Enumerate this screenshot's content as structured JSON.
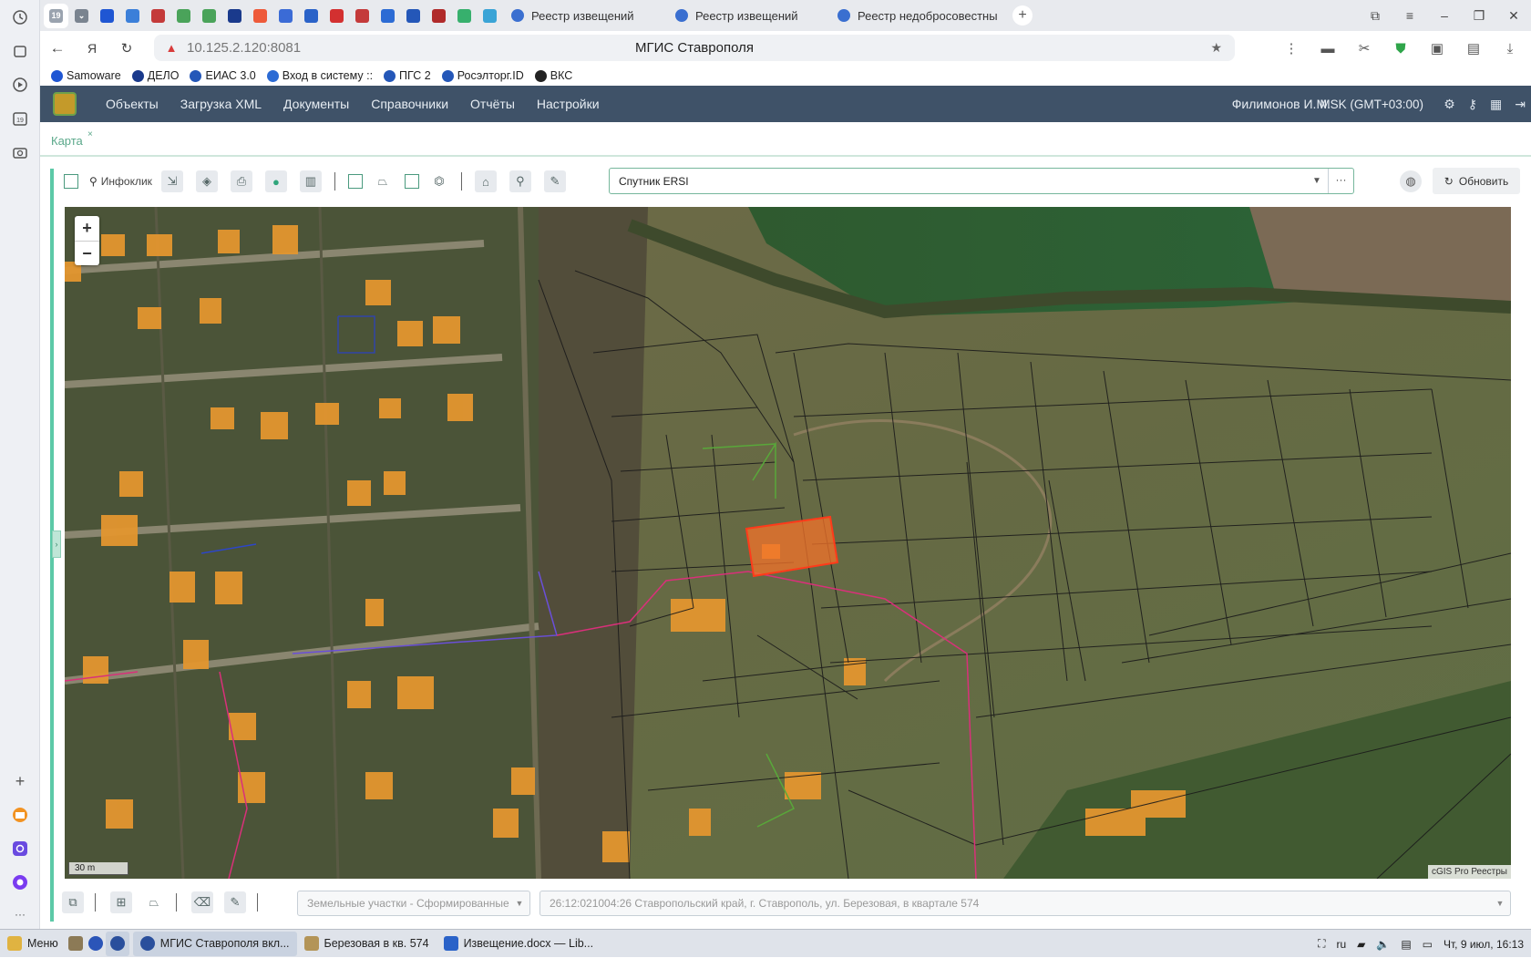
{
  "browser": {
    "pinned_tabs": [
      {
        "name": "pinned-tab-19",
        "text": "19",
        "color": "#9aa3af"
      },
      {
        "name": "pinned-tab-menu",
        "text": "⌄",
        "color": "#7a8490"
      },
      {
        "name": "pinned-tab-1",
        "text": "",
        "color": "#1f56d3"
      },
      {
        "name": "pinned-tab-2",
        "text": "",
        "color": "#3b7fd9"
      },
      {
        "name": "pinned-tab-3",
        "text": "",
        "color": "#c43a3a"
      },
      {
        "name": "pinned-tab-4",
        "text": "",
        "color": "#4aa35a"
      },
      {
        "name": "pinned-tab-5",
        "text": "",
        "color": "#4aa35a"
      },
      {
        "name": "pinned-tab-6",
        "text": "",
        "color": "#1a3a8c"
      },
      {
        "name": "pinned-tab-7",
        "text": "",
        "color": "#ee5a3a"
      },
      {
        "name": "pinned-tab-8",
        "text": "",
        "color": "#3b6bd6"
      },
      {
        "name": "pinned-tab-9",
        "text": "",
        "color": "#2a62c8"
      },
      {
        "name": "pinned-tab-10",
        "text": "",
        "color": "#d33030"
      },
      {
        "name": "pinned-tab-11",
        "text": "",
        "color": "#c43a3a"
      },
      {
        "name": "pinned-tab-12",
        "text": "",
        "color": "#2c6bd4"
      },
      {
        "name": "pinned-tab-13",
        "text": "",
        "color": "#2457b8"
      },
      {
        "name": "pinned-tab-14",
        "text": "",
        "color": "#b02a2a"
      },
      {
        "name": "pinned-tab-15",
        "text": "",
        "color": "#37b06d"
      },
      {
        "name": "pinned-tab-16",
        "text": "",
        "color": "#3aa4d6"
      }
    ],
    "tabs": [
      {
        "label": "Реестр извещений"
      },
      {
        "label": "Реестр извещений"
      },
      {
        "label": "Реестр недобросовестны"
      }
    ],
    "url": "10.125.2.120:8081",
    "page_title": "МГИС Ставрополя",
    "bookmarks": [
      {
        "label": "Samoware",
        "color": "#1f56d3"
      },
      {
        "label": "ДЕЛО",
        "color": "#1a3a8c"
      },
      {
        "label": "ЕИАС 3.0",
        "color": "#2457b8"
      },
      {
        "label": "Вход в систему ::",
        "color": "#2c6bd4"
      },
      {
        "label": "ПГС 2",
        "color": "#2457b8"
      },
      {
        "label": "Росэлторг.ID",
        "color": "#2457b8"
      },
      {
        "label": "ВКС",
        "color": "#222222"
      }
    ]
  },
  "app": {
    "menu": [
      "Объекты",
      "Загрузка XML",
      "Документы",
      "Справочники",
      "Отчёты",
      "Настройки"
    ],
    "user": "Филимонов И.М.",
    "timezone": "MSK (GMT+03:00)",
    "workspace_tab": "Карта",
    "workspace_tab_close": "×"
  },
  "toolbar": {
    "infoclick_label": "Инфоклик",
    "basemap_value": "Спутник ERSI",
    "more_label": "···",
    "refresh_label": "Обновить"
  },
  "map": {
    "zoom_in": "+",
    "zoom_out": "−",
    "scale_label": "30 m",
    "attribution": "cGIS Pro Реестры"
  },
  "bottom": {
    "layer_placeholder": "Земельные участки - Сформированные",
    "object_placeholder": "26:12:021004:26 Ставропольский край, г. Ставрополь, ул. Березовая, в квартале 574"
  },
  "taskbar": {
    "start_label": "Меню",
    "windows": [
      {
        "label": "МГИС Ставрополя вкл...",
        "active": true
      },
      {
        "label": "Березовая в кв. 574",
        "active": false
      },
      {
        "label": "Извещение.docx — Lib...",
        "active": false
      }
    ],
    "lang": "ru",
    "clock": "Чт, 9 июл, 16:13"
  },
  "colors": {
    "header_bg": "#3f5268",
    "accent": "#5cc9a7",
    "selection": "#f4732a"
  }
}
